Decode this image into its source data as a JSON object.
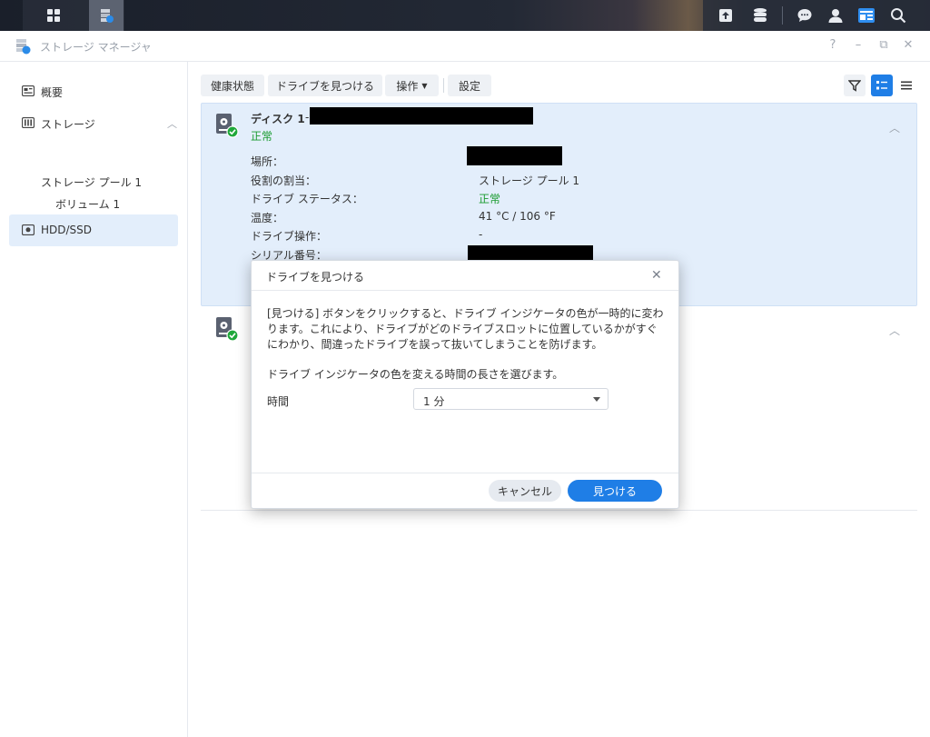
{
  "window": {
    "title": "ストレージ マネージャ",
    "controls": [
      "?",
      "–",
      "⧉",
      "✕"
    ]
  },
  "sidebar": {
    "items": [
      {
        "label": "概要"
      },
      {
        "label": "ストレージ"
      },
      {
        "label": "HDD/SSD"
      }
    ],
    "sub_items": [
      "ストレージ プール 1",
      "ボリューム 1"
    ]
  },
  "toolbar": {
    "health": "健康状態",
    "find_drive": "ドライブを見つける",
    "action": "操作",
    "settings": "設定"
  },
  "disk1": {
    "title": "ディスク 1",
    "title_sep": "-",
    "status": "正常",
    "props": [
      {
        "label": "場所：",
        "value": ""
      },
      {
        "label": "役割の割当：",
        "value": "ストレージ プール 1"
      },
      {
        "label": "ドライブ ステータス：",
        "value": "正常"
      },
      {
        "label": "温度：",
        "value": "41 °C / 106 °F"
      },
      {
        "label": "ドライブ操作：",
        "value": "-"
      },
      {
        "label": "シリアル番号：",
        "value": ""
      }
    ]
  },
  "dialog": {
    "title": "ドライブを見つける",
    "close": "✕",
    "description": "[見つける] ボタンをクリックすると、ドライブ インジケータの色が一時的に変わります。これにより、ドライブがどのドライブスロットに位置しているかがすぐにわかり、間違ったドライブを誤って抜いてしまうことを防げます。",
    "instruction": "ドライブ インジケータの色を変える時間の長さを選びます。",
    "time_label": "時間",
    "time_value": "1 分",
    "cancel": "キャンセル",
    "find": "見つける"
  },
  "colors": {
    "accent": "#1f7ee6",
    "ok": "#1a9b2f",
    "selected_bg": "#e3eefb"
  }
}
